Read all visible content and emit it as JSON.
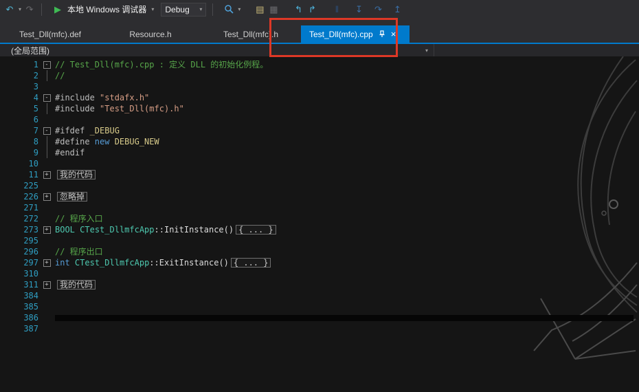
{
  "colors": {
    "accent": "#007acc",
    "annotation_red": "#dd3826",
    "editor_bg": "#151515",
    "chrome_bg": "#2d2d30",
    "line_number": "#2f9ec2",
    "comment_green": "#57a64a",
    "keyword_blue": "#569cd6",
    "string_orange": "#d69d85",
    "macro_yellow": "#d8cb8a",
    "type_teal": "#4ec9b0"
  },
  "toolbar": {
    "debug_target": "本地 Windows 调试器",
    "configuration": "Debug",
    "glyphs": {
      "nav_back": "↶",
      "nav_forward": "↷",
      "caret": "▾",
      "play": "▶",
      "list_a": "▤",
      "list_b": "▦",
      "arrow_a": "↰",
      "arrow_b": "↱",
      "pause": "‖",
      "step_into": "↧",
      "step_over": "↷",
      "step_out": "↥"
    }
  },
  "tabs": [
    {
      "label": "Test_Dll(mfc).def",
      "active": false
    },
    {
      "label": "Resource.h",
      "active": false
    },
    {
      "label": "Test_Dll(mfc).h",
      "active": false
    },
    {
      "label": "Test_Dll(mfc).cpp",
      "active": true
    }
  ],
  "tabs_ui": {
    "close": "×"
  },
  "navbar": {
    "scope": "(全局范围)",
    "caret": "▾"
  },
  "editor": {
    "lines": [
      {
        "num": 1,
        "fold": "minus",
        "tokens": [
          {
            "c": "comment",
            "t": "// Test_Dll(mfc).cpp : 定义 DLL 的初始化例程。"
          }
        ]
      },
      {
        "num": 2,
        "fold": "line",
        "tokens": [
          {
            "c": "comment",
            "t": "//"
          }
        ]
      },
      {
        "num": 3,
        "tokens": []
      },
      {
        "num": 4,
        "fold": "minus",
        "tokens": [
          {
            "c": "preproc",
            "t": "#include "
          },
          {
            "c": "string",
            "t": "\"stdafx.h\""
          }
        ]
      },
      {
        "num": 5,
        "fold": "line",
        "tokens": [
          {
            "c": "preproc",
            "t": "#include "
          },
          {
            "c": "string",
            "t": "\"Test_Dll(mfc).h\""
          }
        ]
      },
      {
        "num": 6,
        "tokens": []
      },
      {
        "num": 7,
        "fold": "minus",
        "tokens": [
          {
            "c": "preproc",
            "t": "#ifdef "
          },
          {
            "c": "macro",
            "t": "_DEBUG"
          }
        ]
      },
      {
        "num": 8,
        "fold": "line",
        "tokens": [
          {
            "c": "preproc",
            "t": "#define "
          },
          {
            "c": "keyword",
            "t": "new "
          },
          {
            "c": "macro",
            "t": "DEBUG_NEW"
          }
        ]
      },
      {
        "num": 9,
        "fold": "line",
        "tokens": [
          {
            "c": "preproc",
            "t": "#endif"
          }
        ]
      },
      {
        "num": 10,
        "tokens": []
      },
      {
        "num": 11,
        "fold": "plus",
        "tokens": [
          {
            "c": "collapsed",
            "t": "我的代码",
            "box": true
          }
        ]
      },
      {
        "num": 225,
        "tokens": []
      },
      {
        "num": 226,
        "fold": "plus",
        "tokens": [
          {
            "c": "collapsed",
            "t": "忽略掉",
            "box": true
          }
        ]
      },
      {
        "num": 271,
        "tokens": []
      },
      {
        "num": 272,
        "tokens": [
          {
            "c": "comment",
            "t": "// 程序入口"
          }
        ]
      },
      {
        "num": 273,
        "fold": "plus",
        "tokens": [
          {
            "c": "type",
            "t": "BOOL"
          },
          {
            "c": "plain",
            "t": " "
          },
          {
            "c": "type",
            "t": "CTest_DllmfcApp"
          },
          {
            "c": "plain",
            "t": "::InitInstance()"
          },
          {
            "c": "collapsed",
            "t": "{ ... }",
            "box": true
          }
        ]
      },
      {
        "num": 295,
        "tokens": []
      },
      {
        "num": 296,
        "tokens": [
          {
            "c": "comment",
            "t": "// 程序出口"
          }
        ]
      },
      {
        "num": 297,
        "fold": "plus",
        "tokens": [
          {
            "c": "keyword",
            "t": "int"
          },
          {
            "c": "plain",
            "t": " "
          },
          {
            "c": "type",
            "t": "CTest_DllmfcApp"
          },
          {
            "c": "plain",
            "t": "::ExitInstance()"
          },
          {
            "c": "collapsed",
            "t": "{ ... }",
            "box": true
          }
        ]
      },
      {
        "num": 310,
        "tokens": []
      },
      {
        "num": 311,
        "fold": "plus",
        "tokens": [
          {
            "c": "collapsed",
            "t": "我的代码",
            "box": true
          }
        ]
      },
      {
        "num": 384,
        "tokens": []
      },
      {
        "num": 385,
        "tokens": []
      },
      {
        "num": 386,
        "bar": true,
        "tokens": []
      },
      {
        "num": 387,
        "tokens": []
      }
    ]
  }
}
